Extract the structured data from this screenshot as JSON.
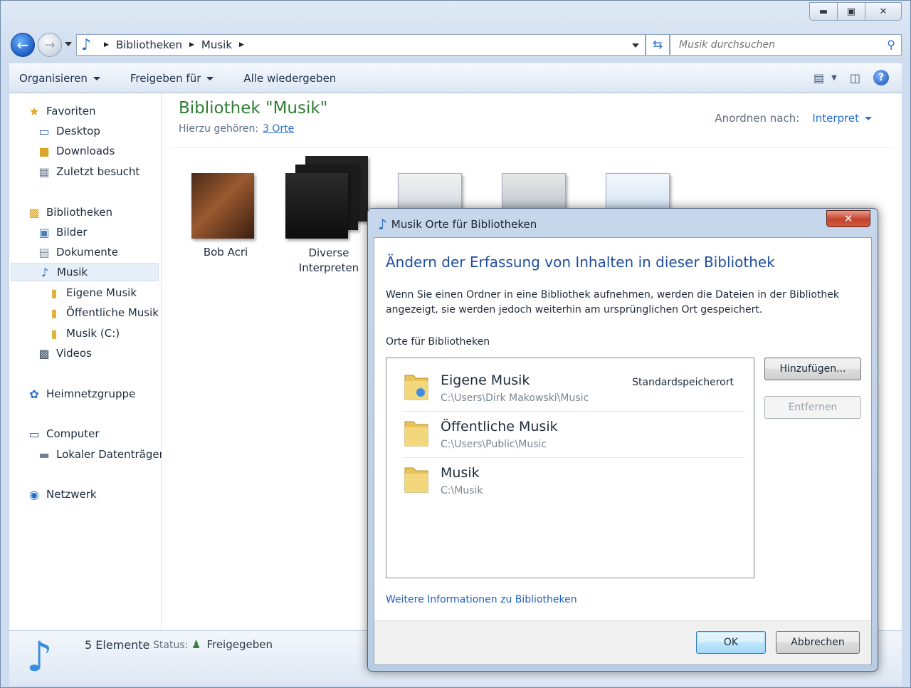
{
  "window": {
    "caption_buttons": [
      "minimize",
      "maximize",
      "close"
    ]
  },
  "nav": {
    "breadcrumbs": [
      "Bibliotheken",
      "Musik"
    ],
    "search_placeholder": "Musik durchsuchen"
  },
  "toolbar": {
    "organize": "Organisieren",
    "share": "Freigeben für",
    "play_all": "Alle wiedergeben"
  },
  "sidebar": {
    "favorites": "Favoriten",
    "desktop": "Desktop",
    "downloads": "Downloads",
    "recent": "Zuletzt besucht",
    "libraries": "Bibliotheken",
    "pictures": "Bilder",
    "documents": "Dokumente",
    "music": "Musik",
    "my_music": "Eigene Musik",
    "public_music": "Öffentliche Musik",
    "music_c": "Musik (C:)",
    "videos": "Videos",
    "homegroup": "Heimnetzgruppe",
    "computer": "Computer",
    "local_disk": "Lokaler Datenträger",
    "network": "Netzwerk"
  },
  "library": {
    "title": "Bibliothek \"Musik\"",
    "includes_label": "Hierzu gehören:",
    "includes_link": "3 Orte",
    "arrange_label": "Anordnen nach:",
    "arrange_value": "Interpret"
  },
  "tiles": [
    {
      "label": "Bob Acri"
    },
    {
      "label": "Diverse Interpreten"
    }
  ],
  "status": {
    "count": "5 Elemente",
    "status_label": "Status:",
    "status_value": "Freigegeben"
  },
  "dialog": {
    "title": "Musik Orte für Bibliotheken",
    "heading": "Ändern der Erfassung von Inhalten in dieser Bibliothek",
    "description": "Wenn Sie einen Ordner in eine Bibliothek aufnehmen, werden die Dateien in der Bibliothek angezeigt, sie werden jedoch weiterhin am ursprünglichen Ort gespeichert.",
    "list_label": "Orte für Bibliotheken",
    "locations": [
      {
        "name": "Eigene Musik",
        "path": "C:\\Users\\Dirk Makowski\\Music",
        "badge": "Standardspeicherort"
      },
      {
        "name": "Öffentliche Musik",
        "path": "C:\\Users\\Public\\Music"
      },
      {
        "name": "Musik",
        "path": "C:\\Musik"
      }
    ],
    "add_button": "Hinzufügen...",
    "remove_button": "Entfernen",
    "more_info_link": "Weitere Informationen zu Bibliotheken",
    "ok_button": "OK",
    "cancel_button": "Abbrechen"
  }
}
